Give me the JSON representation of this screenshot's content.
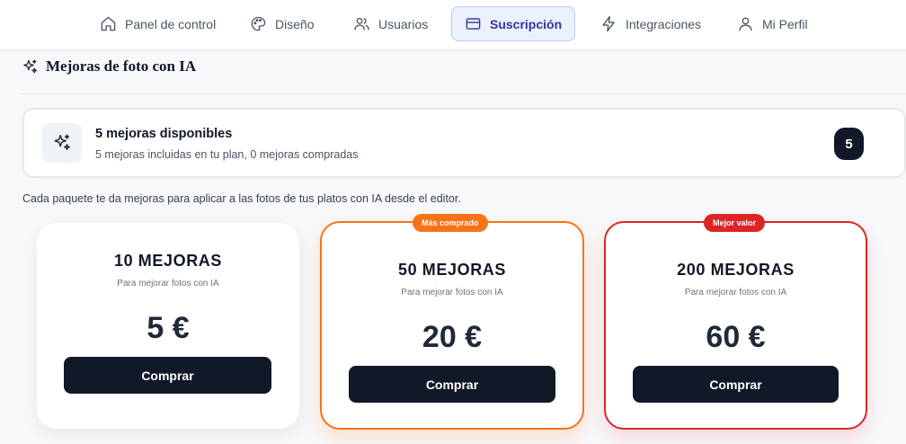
{
  "nav": {
    "tabs": [
      {
        "label": "Panel de control",
        "icon": "home-icon"
      },
      {
        "label": "Diseño",
        "icon": "palette-icon"
      },
      {
        "label": "Usuarios",
        "icon": "users-icon"
      },
      {
        "label": "Suscripción",
        "icon": "credit-card-icon",
        "active": true
      },
      {
        "label": "Integraciones",
        "icon": "lightning-icon"
      },
      {
        "label": "Mi Perfil",
        "icon": "user-icon"
      }
    ]
  },
  "section": {
    "title": "Mejoras de foto con IA",
    "icon": "sparkles-icon"
  },
  "status": {
    "title": "5 mejoras disponibles",
    "subtitle": "5 mejoras incluidas en tu plan, 0 mejoras compradas",
    "count": "5",
    "icon": "sparkles-icon"
  },
  "intro": "Cada paquete te da mejoras para aplicar a las fotos de tus platos con IA desde el editor.",
  "packs": [
    {
      "title": "10 MEJORAS",
      "subtitle": "Para mejorar fotos con IA",
      "price": "5 €",
      "button": "Comprar",
      "ribbon": ""
    },
    {
      "title": "50 MEJORAS",
      "subtitle": "Para mejorar fotos con IA",
      "price": "20 €",
      "button": "Comprar",
      "ribbon": "Más comprado"
    },
    {
      "title": "200 MEJORAS",
      "subtitle": "Para mejorar fotos con IA",
      "price": "60 €",
      "button": "Comprar",
      "ribbon": "Mejor valor"
    }
  ],
  "colors": {
    "accent": "#3730a3",
    "dark": "#111827",
    "popular": "#f97316",
    "best_value": "#dc2626"
  }
}
